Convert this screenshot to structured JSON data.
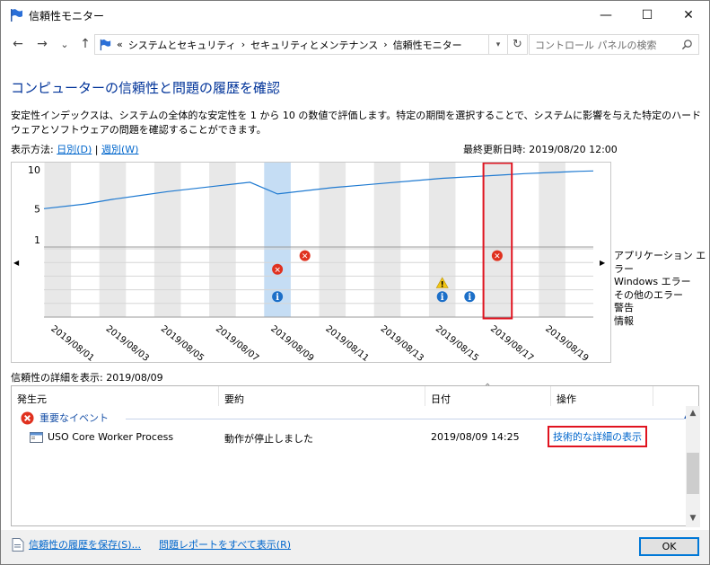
{
  "window": {
    "title": "信頼性モニター",
    "minimize_glyph": "—",
    "maximize_glyph": "☐",
    "close_glyph": "✕"
  },
  "nav": {
    "back_glyph": "←",
    "forward_glyph": "→",
    "recent_glyph": "⌄",
    "up_glyph": "↑",
    "breadcrumb_prefix": "«",
    "crumbs": [
      "システムとセキュリティ",
      "セキュリティとメンテナンス",
      "信頼性モニター"
    ],
    "crumb_sep": "›",
    "search_placeholder": "コントロール パネルの検索"
  },
  "header": {
    "title": "コンピューターの信頼性と問題の履歴を確認",
    "description": "安定性インデックスは、システムの全体的な安定性を 1 から 10 の数値で評価します。特定の期間を選択することで、システムに影響を与えた特定のハードウェアとソフトウェアの問題を確認することができます。",
    "view_by_label": "表示方法:",
    "view_daily": "日別(D)",
    "view_sep": "|",
    "view_weekly": "週別(W)",
    "last_updated": "最終更新日時: 2019/08/20 12:00"
  },
  "chart_data": {
    "type": "line",
    "title": "",
    "ylim": [
      1,
      10
    ],
    "y_ticks": [
      "10",
      "5",
      "1"
    ],
    "x_labels": [
      "2019/08/01",
      "2019/08/03",
      "2019/08/05",
      "2019/08/07",
      "2019/08/09",
      "2019/08/11",
      "2019/08/13",
      "2019/08/15",
      "2019/08/17",
      "2019/08/19"
    ],
    "day_count": 20,
    "selected_day": 9,
    "highlighted_day": 17,
    "series": [
      {
        "values": [
          5.0,
          5.6,
          6.2,
          6.7,
          7.2,
          7.6,
          8.0,
          8.4,
          6.9,
          7.3,
          7.7,
          8.0,
          8.3,
          8.6,
          8.9,
          9.1,
          9.3,
          9.5,
          9.65,
          9.8
        ]
      }
    ],
    "legend": [
      "アプリケーション エラー",
      "Windows エラー",
      "その他のエラー",
      "警告",
      "情報"
    ],
    "events": [
      {
        "day": 9,
        "row": 2,
        "kind": "error"
      },
      {
        "day": 10,
        "row": 1,
        "kind": "error"
      },
      {
        "day": 9,
        "row": 4,
        "kind": "info"
      },
      {
        "day": 15,
        "row": 3,
        "kind": "warning"
      },
      {
        "day": 15,
        "row": 4,
        "kind": "info"
      },
      {
        "day": 16,
        "row": 4,
        "kind": "info"
      },
      {
        "day": 17,
        "row": 1,
        "kind": "error"
      }
    ],
    "error_glyph": "✕",
    "info_glyph": "i",
    "warning_glyph": "!",
    "colors": {
      "line": "#1f7ad1",
      "stripe": "#e8e8e8",
      "selected": "#c5ddf4",
      "highlight_box": "#e0131f",
      "error": "#e0311f",
      "info": "#1c6fc8",
      "warning": "#f2c511"
    }
  },
  "details": {
    "title": "信頼性の詳細を表示: 2019/08/09",
    "columns": {
      "source": "発生元",
      "summary": "要約",
      "date": "日付",
      "action": "操作"
    },
    "group_label": "重要なイベント",
    "rows": [
      {
        "source": "USO Core Worker Process",
        "summary": "動作が停止しました",
        "date": "2019/08/09 14:25",
        "action": "技術的な詳細の表示"
      }
    ]
  },
  "footer": {
    "save_history": "信頼性の履歴を保存(S)...",
    "view_all_reports": "問題レポートをすべて表示(R)",
    "ok": "OK"
  }
}
